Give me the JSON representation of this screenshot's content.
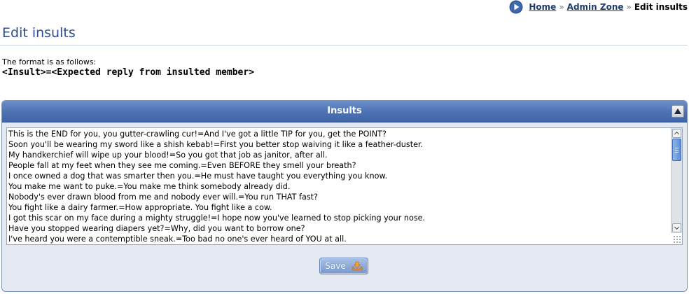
{
  "breadcrumb": {
    "items": [
      {
        "label": "Home"
      },
      {
        "label": "Admin Zone"
      }
    ],
    "separator": "»",
    "current": "Edit insults"
  },
  "page": {
    "title": "Edit insults",
    "format_intro": "The format is as follows:",
    "format_code": "<Insult>=<Expected reply from insulted member>"
  },
  "panel": {
    "title": "Insults",
    "insults": [
      "This is the END for you, you gutter-crawling cur!=And I've got a little TIP for you, get the POINT?",
      "Soon you'll be wearing my sword like a shish kebab!=First you better stop waiving it like a feather-duster.",
      "My handkerchief will wipe up your blood!=So you got that job as janitor, after all.",
      "People fall at my feet when they see me coming.=Even BEFORE they smell your breath?",
      "I once owned a dog that was smarter then you.=He must have taught you everything you know.",
      "You make me want to puke.=You make me think somebody already did.",
      "Nobody's ever drawn blood from me and nobody ever will.=You run THAT fast?",
      "You fight like a dairy farmer.=How appropriate. You fight like a cow.",
      "I got this scar on my face during a mighty struggle!=I hope now you've learned to stop picking your nose.",
      "Have you stopped wearing diapers yet?=Why, did you want to borrow one?",
      "I've heard you were a contemptible sneak.=Too bad no one's ever heard of YOU at all."
    ],
    "save_label": "Save"
  },
  "colors": {
    "header_blue": "#4f74b4",
    "title_blue": "#2b4f8f",
    "link_blue": "#1d3b6e",
    "panel_bg": "#e4e9f1",
    "save_icon_orange": "#e8922e"
  },
  "icons": {
    "breadcrumb": "play-circle-icon",
    "collapse": "collapse-up-icon",
    "save": "save-download-icon"
  }
}
